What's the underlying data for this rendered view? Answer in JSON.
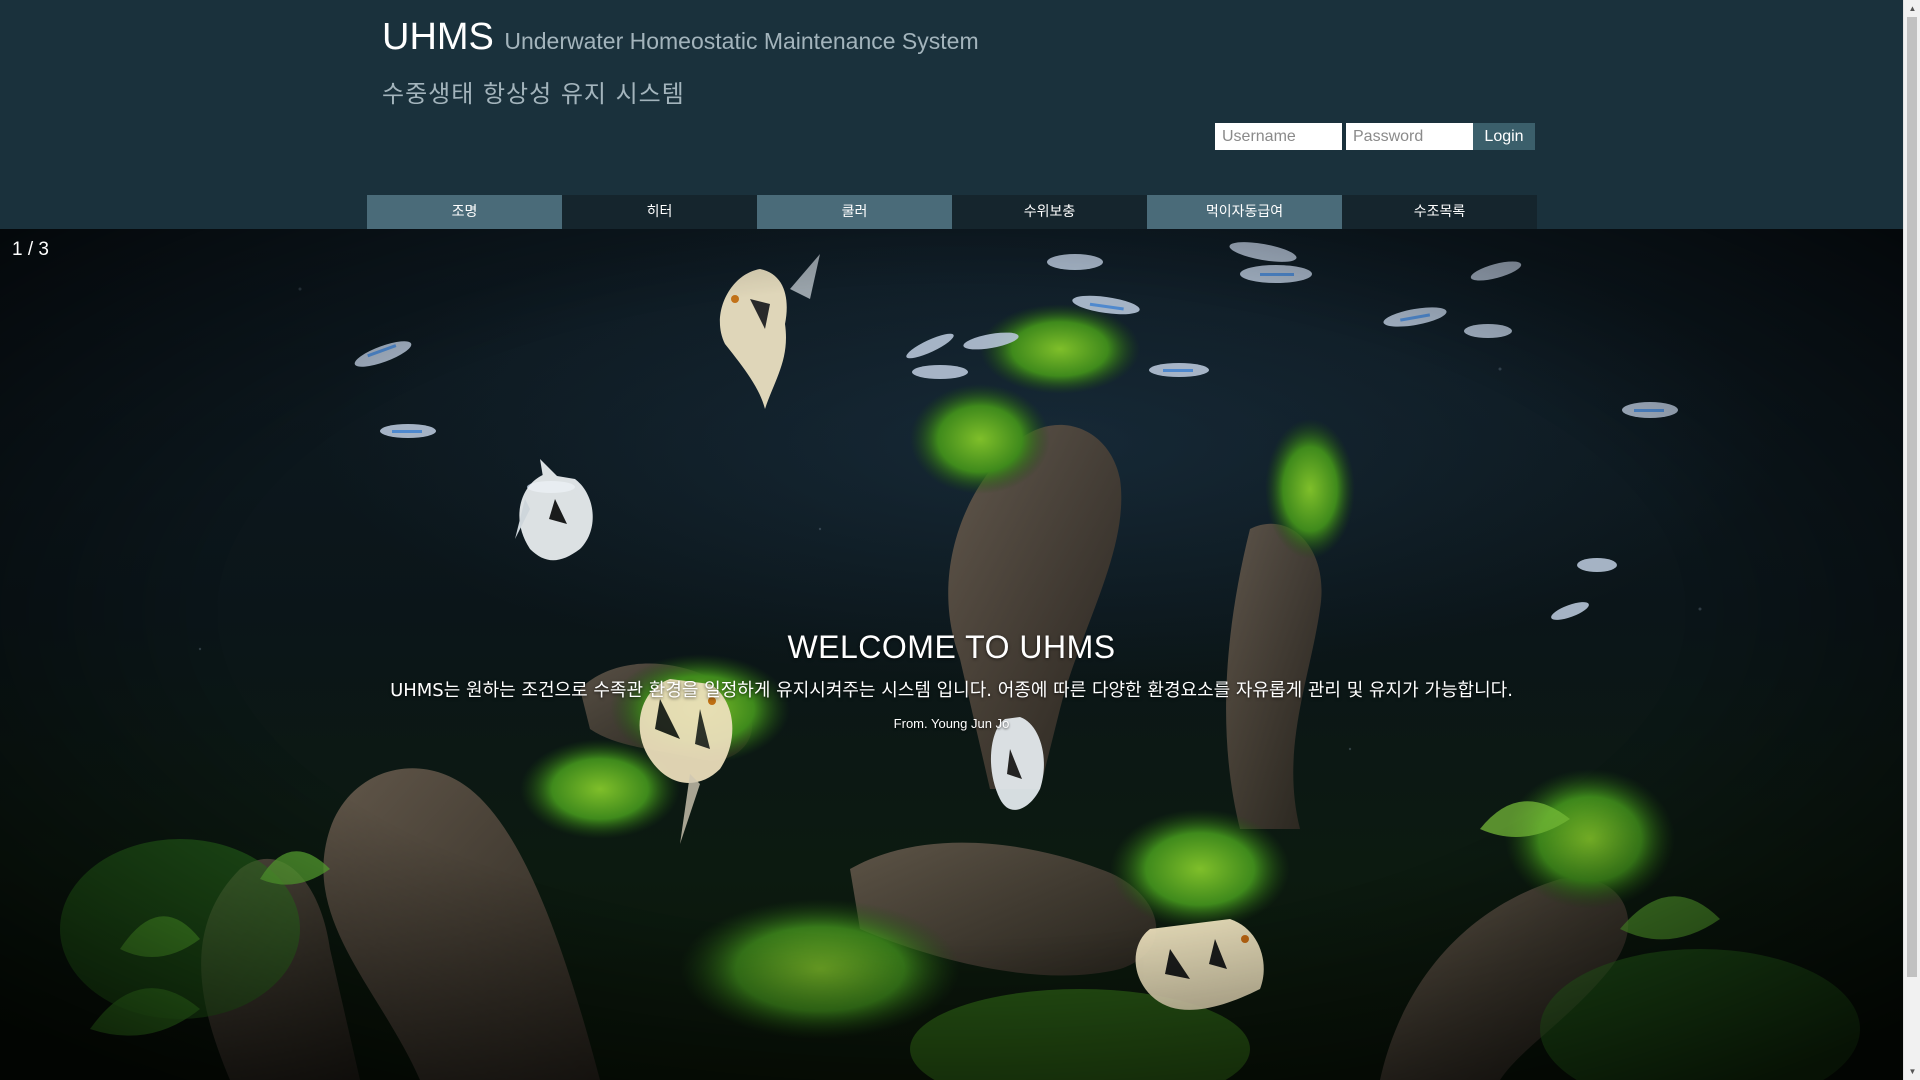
{
  "header": {
    "title": "UHMS",
    "subtitle": "Underwater Homeostatic Maintenance System",
    "korean_title": "수중생태 항상성 유지 시스템"
  },
  "login": {
    "username_placeholder": "Username",
    "password_placeholder": "Password",
    "button_label": "Login"
  },
  "nav": {
    "items": [
      {
        "label": "조명"
      },
      {
        "label": "히터"
      },
      {
        "label": "쿨러"
      },
      {
        "label": "수위보충"
      },
      {
        "label": "먹이자동급여"
      },
      {
        "label": "수조목록"
      }
    ]
  },
  "hero": {
    "counter": "1 / 3",
    "title": "WELCOME TO UHMS",
    "description": "UHMS는 원하는 조건으로 수족관 환경을 일정하게 유지시켜주는 시스템 입니다. 어종에 따른 다양한 환경요소를 자유롭게 관리 및 유지가 가능합니다.",
    "from": "From. Young Jun Jo"
  },
  "colors": {
    "header_bg": "#1a313c",
    "nav_light": "#4a6b79",
    "nav_dark": "#15252d",
    "login_button": "#3b5f6b"
  }
}
